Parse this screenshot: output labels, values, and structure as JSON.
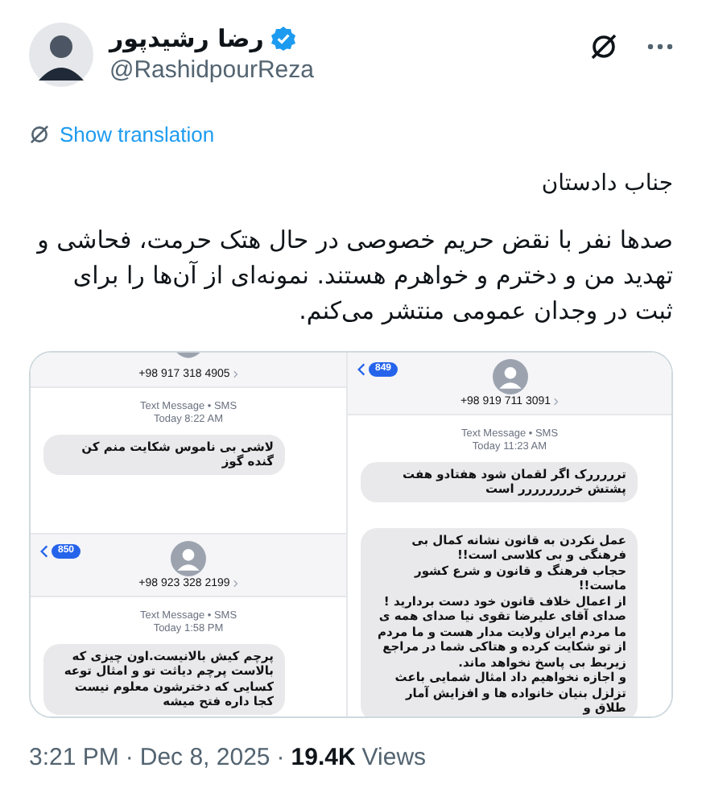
{
  "author": {
    "name": "رضا رشیدپور",
    "verified": true,
    "handle": "@RashidpourReza"
  },
  "translate": {
    "label": "Show translation"
  },
  "body": {
    "greeting": "جناب دادستان",
    "paragraph": "صدها نفر با نقض حریم خصوصی در حال هتک حرمت، فحاشی و تهدید من و دخترم و خواهرم هستند. نمونه‌ای از آن‌ها را برای ثبت در وجدان عمومی منتشر می‌کنم."
  },
  "media": {
    "left_column": {
      "screenshots": [
        {
          "kind": "cropped",
          "number": "+98 917 318 4905",
          "service": "Text Message • SMS",
          "time": "Today 8:22 AM",
          "messages": [
            "لاشی بی ناموس شکایت منم کن گنده گوز"
          ]
        },
        {
          "kind": "full",
          "badge": "850",
          "number": "+98 923 328 2199",
          "service": "Text Message • SMS",
          "time": "Today 1:58 PM",
          "messages": [
            "پرچم کیش بالانیست.اون چیزی که بالاست پرچم دیاثت تو و امثال توعه\nکسایی که دخترشون معلوم نیست کجا داره فتح میشه"
          ]
        }
      ]
    },
    "right_column": {
      "screenshots": [
        {
          "kind": "full",
          "badge": "849",
          "number": "+98 919 711 3091",
          "service": "Text Message • SMS",
          "time": "Today 11:23 AM",
          "messages": [
            "ترررررک اگر لقمان شود هفتادو هفت پشتش خرررررررر است",
            "عمل نکردن به قانون نشانه کمال بی فرهنگی و بی کلاسی است!!\nحجاب فرهنگ و قانون و شرع کشور ماست!!\nاز اعمال خلاف قانون خود دست بردارید !\nصدای آقای علیرضا تقوی نیا صدای همه ی ما مردم ایران ولایت مدار هست و ما مردم از تو شکایت کرده و هتاکی شما در مراجع زیربط بی پاسخ نخواهد ماند.\nو اجازه نخواهیم داد امثال شمایی باعث تزلزل بنیان خانواده ها و افزایش آمار طلاق و"
          ]
        }
      ]
    }
  },
  "meta": {
    "time": "3:21 PM",
    "separator_1": "·",
    "date": "Dec 8, 2025",
    "separator_2": "·",
    "views_count": "19.4K",
    "views_label": "Views"
  }
}
